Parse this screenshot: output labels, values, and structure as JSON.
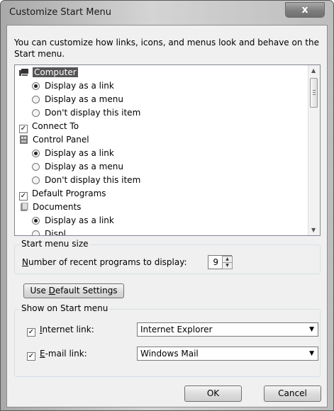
{
  "window": {
    "title": "Customize Start Menu",
    "close_label": "x"
  },
  "description": "You can customize how links, icons, and menus look and behave on the Start menu.",
  "list": {
    "computer": {
      "label": "Computer",
      "options": [
        "Display as a link",
        "Display as a menu",
        "Don't display this item"
      ],
      "selected": "Display as a link"
    },
    "connect_to": {
      "label": "Connect To",
      "checked": true
    },
    "control_panel": {
      "label": "Control Panel",
      "options": [
        "Display as a link",
        "Display as a menu",
        "Don't display this item"
      ],
      "selected": "Display as a link"
    },
    "default_programs": {
      "label": "Default Programs",
      "checked": true
    },
    "documents": {
      "label": "Documents",
      "options": [
        "Display as a link",
        "Displ..."
      ],
      "selected": "Display as a link"
    }
  },
  "start_menu_size": {
    "group_label": "Start menu size",
    "recent_programs": {
      "prefix": "",
      "underlined": "N",
      "rest": "umber of recent programs to display:",
      "value": "9"
    }
  },
  "default_button": {
    "pre": "Use ",
    "underlined": "D",
    "post": "efault Settings"
  },
  "show_on_start": {
    "group_label": "Show on Start menu",
    "internet": {
      "underlined": "I",
      "rest": "nternet link:",
      "checked": true,
      "value": "Internet Explorer"
    },
    "email": {
      "underlined": "E",
      "rest": "-mail link:",
      "checked": true,
      "value": "Windows Mail"
    }
  },
  "buttons": {
    "ok": "OK",
    "cancel": "Cancel"
  },
  "icons": {
    "computer": "computer-icon",
    "control_panel": "control-panel-icon",
    "documents": "documents-icon",
    "close": "close-icon"
  }
}
